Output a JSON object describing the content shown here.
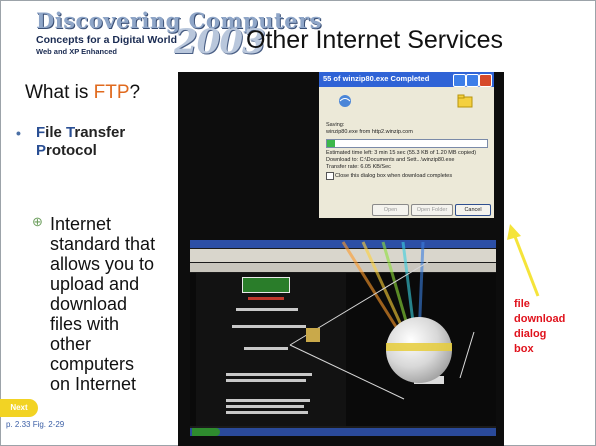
{
  "logo": {
    "title": "Discovering Computers",
    "subtitle": "Concepts for a Digital World",
    "edition": "Web and XP Enhanced",
    "year": "2003"
  },
  "slide_title": "Other Internet Services",
  "question": {
    "prefix": "What is ",
    "highlight": "FTP",
    "suffix": "?"
  },
  "bullet1": {
    "marker": "•",
    "F": "F",
    "ile": "ile ",
    "T": "T",
    "ransfer": "ransfer",
    "P": "P",
    "rotocol": "rotocol"
  },
  "bullet2": {
    "marker": "⊕",
    "lines": [
      "Internet",
      "standard that",
      "allows you to",
      "upload and",
      "download",
      "files with",
      "other",
      "computers",
      "on Internet"
    ]
  },
  "nav": {
    "next_label": "Next"
  },
  "reference": "p. 2.33 Fig. 2-29",
  "dialog": {
    "title": "55 of winzip80.exe Completed",
    "saving_label": "Saving:",
    "saving_value": "winzip80.exe from http2.winzip.com",
    "time_left": "Estimated time left:  3 min 15 sec (55.3 KB of 1.20 MB copied)",
    "download_to": "Download to:      C:\\Documents and Sett...\\winzip80.exe",
    "transfer_rate": "Transfer rate:       6.05 KB/Sec",
    "close_checkbox": "Close this dialog box when download completes",
    "progress_fraction": 0.05,
    "buttons": [
      "Open",
      "Open Folder",
      "Cancel"
    ]
  },
  "caption_lines": [
    "file",
    "download",
    "dialog",
    "box"
  ],
  "colors": {
    "ftp_highlight": "#e06a1e",
    "caption": "#e0121c",
    "arrow": "#f5e43a",
    "next_button": "#f2d324"
  }
}
